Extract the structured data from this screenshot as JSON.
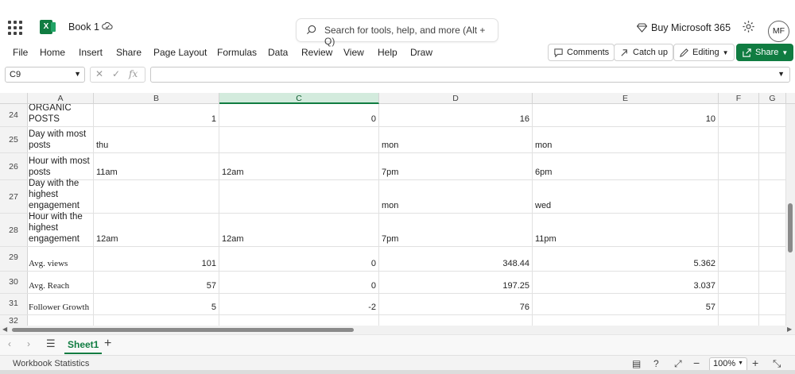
{
  "app": {
    "doc_name": "Book 1",
    "search_placeholder": "Search for tools, help, and more (Alt + Q)",
    "buy_label": "Buy Microsoft 365",
    "avatar_initials": "MF",
    "accent": "#107c41"
  },
  "menu": [
    "File",
    "Home",
    "Insert",
    "Share",
    "Page Layout",
    "Formulas",
    "Data",
    "Review",
    "View",
    "Help",
    "Draw"
  ],
  "ribbon_buttons": {
    "comments": "Comments",
    "catchup": "Catch up",
    "editing": "Editing",
    "share": "Share"
  },
  "formula_bar": {
    "name_box": "C9",
    "fx_label": "fx",
    "formula": ""
  },
  "columns": [
    "A",
    "B",
    "C",
    "D",
    "E",
    "F",
    "G"
  ],
  "selected_column": "C",
  "rows": [
    {
      "num": "24",
      "a": "ORGANIC\nPOSTS",
      "b": "1",
      "c": "0",
      "d": "16",
      "e": "10"
    },
    {
      "num": "25",
      "a": "Day with most\nposts",
      "b": "thu",
      "c": "",
      "d": "mon",
      "e": "mon"
    },
    {
      "num": "26",
      "a": "Hour with most\nposts",
      "b": "11am",
      "c": "12am",
      "d": "7pm",
      "e": "6pm"
    },
    {
      "num": "27",
      "a": "Day with the\nhighest\nengagement",
      "b": "",
      "c": "",
      "d": "mon",
      "e": "wed"
    },
    {
      "num": "28",
      "a": "Hour with the\nhighest\nengagement",
      "b": "12am",
      "c": "12am",
      "d": "7pm",
      "e": "11pm"
    },
    {
      "num": "29",
      "a": "Avg. views",
      "b": "101",
      "c": "0",
      "d": "348.44",
      "e": "5.362"
    },
    {
      "num": "30",
      "a": "Avg. Reach",
      "b": "57",
      "c": "0",
      "d": "197.25",
      "e": "3.037"
    },
    {
      "num": "31",
      "a": "Follower Growth",
      "b": "5",
      "c": "-2",
      "d": "76",
      "e": "57"
    },
    {
      "num": "32",
      "a": "",
      "b": "",
      "c": "",
      "d": "",
      "e": ""
    }
  ],
  "sheet": {
    "tab_label": "Sheet1"
  },
  "status": {
    "workbook_stats": "Workbook Statistics",
    "zoom": "100%"
  }
}
